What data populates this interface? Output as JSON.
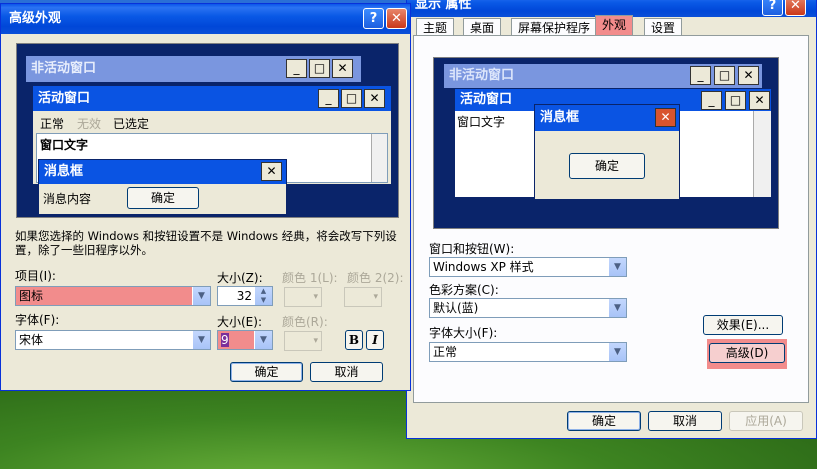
{
  "display_properties": {
    "title": "显示 属性",
    "tabs": [
      "主题",
      "桌面",
      "屏幕保护程序",
      "外观",
      "设置"
    ],
    "active_tab": "外观",
    "preview": {
      "inactive_window": "非活动窗口",
      "active_window": "活动窗口",
      "window_text": "窗口文字",
      "message_box": "消息框",
      "ok": "确定"
    },
    "windows_buttons_label": "窗口和按钮(W):",
    "windows_buttons_value": "Windows XP 样式",
    "color_scheme_label": "色彩方案(C):",
    "color_scheme_value": "默认(蓝)",
    "font_size_label": "字体大小(F):",
    "font_size_value": "正常",
    "effects_button": "效果(E)...",
    "advanced_button": "高级(D)",
    "ok_button": "确定",
    "cancel_button": "取消",
    "apply_button": "应用(A)"
  },
  "advanced": {
    "title": "高级外观",
    "preview": {
      "inactive_window": "非活动窗口",
      "active_window": "活动窗口",
      "menu_normal": "正常",
      "menu_disabled": "无效",
      "menu_selected": "已选定",
      "window_text": "窗口文字",
      "message_box": "消息框",
      "message_text": "消息内容",
      "ok": "确定"
    },
    "info_text": "如果您选择的 Windows 和按钮设置不是 Windows 经典，将会改写下列设置，除了一些旧程序以外。",
    "item_label": "项目(I):",
    "item_value": "图标",
    "size_label": "大小(Z):",
    "size_value": "32",
    "color1_label": "颜色 1(L):",
    "color2_label": "颜色 2(2):",
    "font_label": "字体(F):",
    "font_value": "宋体",
    "font_size_label": "大小(E):",
    "font_size_value": "9",
    "font_color_label": "颜色(R):",
    "bold": "B",
    "italic": "I",
    "ok_button": "确定",
    "cancel_button": "取消"
  }
}
